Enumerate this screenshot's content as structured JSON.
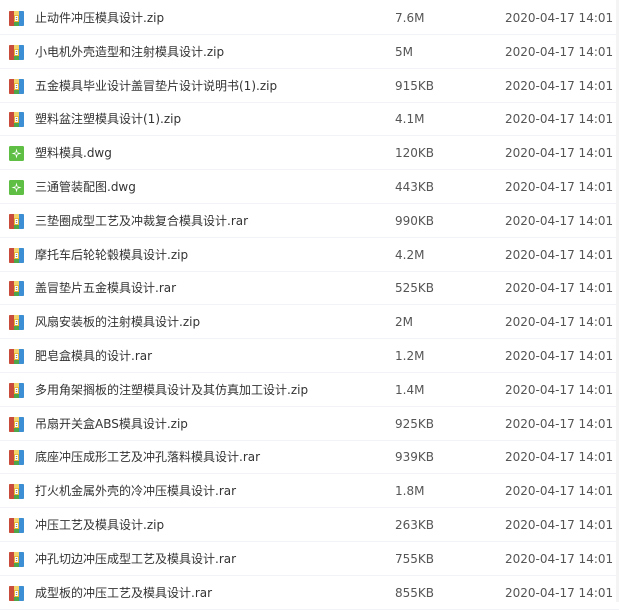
{
  "colors": {
    "zip_icon_left": "#c84b3c",
    "zip_icon_middle": "#e8b737",
    "zip_icon_right": "#3c8fd4",
    "dwg_icon": "#5fbf45"
  },
  "files": [
    {
      "name": "止动件冲压模具设计.zip",
      "size": "7.6M",
      "date": "2020-04-17 14:01",
      "icon": "archive-icon"
    },
    {
      "name": "小电机外壳造型和注射模具设计.zip",
      "size": "5M",
      "date": "2020-04-17 14:01",
      "icon": "archive-icon"
    },
    {
      "name": "五金模具毕业设计盖冒垫片设计说明书(1).zip",
      "size": "915KB",
      "date": "2020-04-17 14:01",
      "icon": "archive-icon"
    },
    {
      "name": "塑料盆注塑模具设计(1).zip",
      "size": "4.1M",
      "date": "2020-04-17 14:01",
      "icon": "archive-icon"
    },
    {
      "name": "塑料模具.dwg",
      "size": "120KB",
      "date": "2020-04-17 14:01",
      "icon": "dwg-icon"
    },
    {
      "name": "三通管装配图.dwg",
      "size": "443KB",
      "date": "2020-04-17 14:01",
      "icon": "dwg-icon"
    },
    {
      "name": "三垫圈成型工艺及冲裁复合模具设计.rar",
      "size": "990KB",
      "date": "2020-04-17 14:01",
      "icon": "archive-icon"
    },
    {
      "name": "摩托车后轮轮毂模具设计.zip",
      "size": "4.2M",
      "date": "2020-04-17 14:01",
      "icon": "archive-icon"
    },
    {
      "name": "盖冒垫片五金模具设计.rar",
      "size": "525KB",
      "date": "2020-04-17 14:01",
      "icon": "archive-icon"
    },
    {
      "name": "风扇安装板的注射模具设计.zip",
      "size": "2M",
      "date": "2020-04-17 14:01",
      "icon": "archive-icon"
    },
    {
      "name": "肥皂盒模具的设计.rar",
      "size": "1.2M",
      "date": "2020-04-17 14:01",
      "icon": "archive-icon"
    },
    {
      "name": "多用角架搁板的注塑模具设计及其仿真加工设计.zip",
      "size": "1.4M",
      "date": "2020-04-17 14:01",
      "icon": "archive-icon"
    },
    {
      "name": "吊扇开关盒ABS模具设计.zip",
      "size": "925KB",
      "date": "2020-04-17 14:01",
      "icon": "archive-icon"
    },
    {
      "name": "底座冲压成形工艺及冲孔落料模具设计.rar",
      "size": "939KB",
      "date": "2020-04-17 14:01",
      "icon": "archive-icon"
    },
    {
      "name": "打火机金属外壳的冷冲压模具设计.rar",
      "size": "1.8M",
      "date": "2020-04-17 14:01",
      "icon": "archive-icon"
    },
    {
      "name": "冲压工艺及模具设计.zip",
      "size": "263KB",
      "date": "2020-04-17 14:01",
      "icon": "archive-icon"
    },
    {
      "name": "冲孔切边冲压成型工艺及模具设计.rar",
      "size": "755KB",
      "date": "2020-04-17 14:01",
      "icon": "archive-icon"
    },
    {
      "name": "成型板的冲压工艺及模具设计.rar",
      "size": "855KB",
      "date": "2020-04-17 14:01",
      "icon": "archive-icon"
    }
  ]
}
